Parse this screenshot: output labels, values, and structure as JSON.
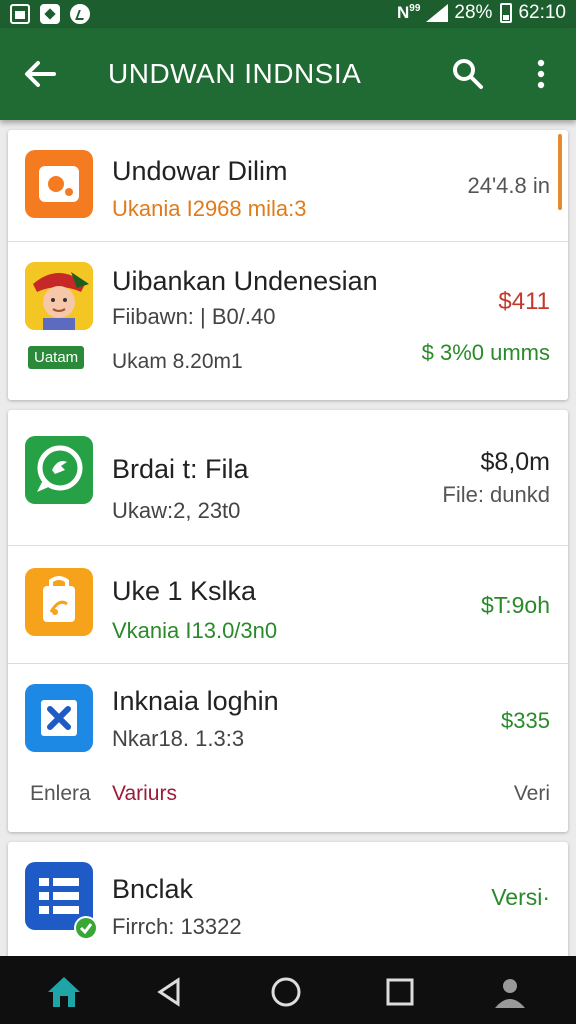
{
  "status_bar": {
    "network_label": "N",
    "network_sup": "99",
    "battery_percent": "28%",
    "time": "62:10"
  },
  "app_bar": {
    "title": "UNDWAN INDNSIA",
    "icons": [
      "back-arrow-icon",
      "search-icon",
      "more-vert-icon"
    ]
  },
  "items": [
    {
      "title": "Undowar Dilim",
      "subtitle": "Ukania I2968 mila:3",
      "right": "24'4.8 in",
      "icon": "image-editor-icon",
      "icon_color": "#f47b20"
    },
    {
      "title": "Uibankan Undenesian",
      "subtitle": "Fiibawn: | B0/.40",
      "badge": "Uatam",
      "detail": "Ukam 8.20m1",
      "price": "$411",
      "right_detail": "$ 3%0 umms",
      "icon": "avatar-character-icon"
    },
    {
      "title": "Brdai t: Fila",
      "subtitle": "Ukaw:2, 23t0",
      "right_top": "$8,0m",
      "right_bottom": "File: dunkd",
      "icon": "chat-bubble-icon",
      "icon_color": "#27a146"
    },
    {
      "title": "Uke 1 Kslka",
      "subtitle": "Vkania I13.0/3n0",
      "right": "$T:9oh",
      "icon": "shopping-bag-icon",
      "icon_color": "#f7a21b"
    },
    {
      "title": "Inknaia loghin",
      "subtitle": "Nkar18. 1.3:3",
      "right": "$335",
      "footer_left": "Enlera",
      "footer_mid": "Variurs",
      "footer_right": "Veri",
      "icon": "close-x-icon",
      "icon_color": "#1e88e5"
    },
    {
      "title": "Bnclak",
      "subtitle": "Firrch: 13322",
      "right": "Versi·",
      "icon": "grid-apps-icon",
      "icon_color": "#1e5bc6"
    }
  ],
  "nav_bar": {
    "icons": [
      "home-icon",
      "back-triangle-icon",
      "home-circle-icon",
      "recents-square-icon",
      "person-icon"
    ]
  },
  "colors": {
    "app_bar": "#1f6b33",
    "accent_orange": "#e07b1a",
    "accent_green": "#2a8a2a",
    "accent_red": "#c0392b"
  }
}
